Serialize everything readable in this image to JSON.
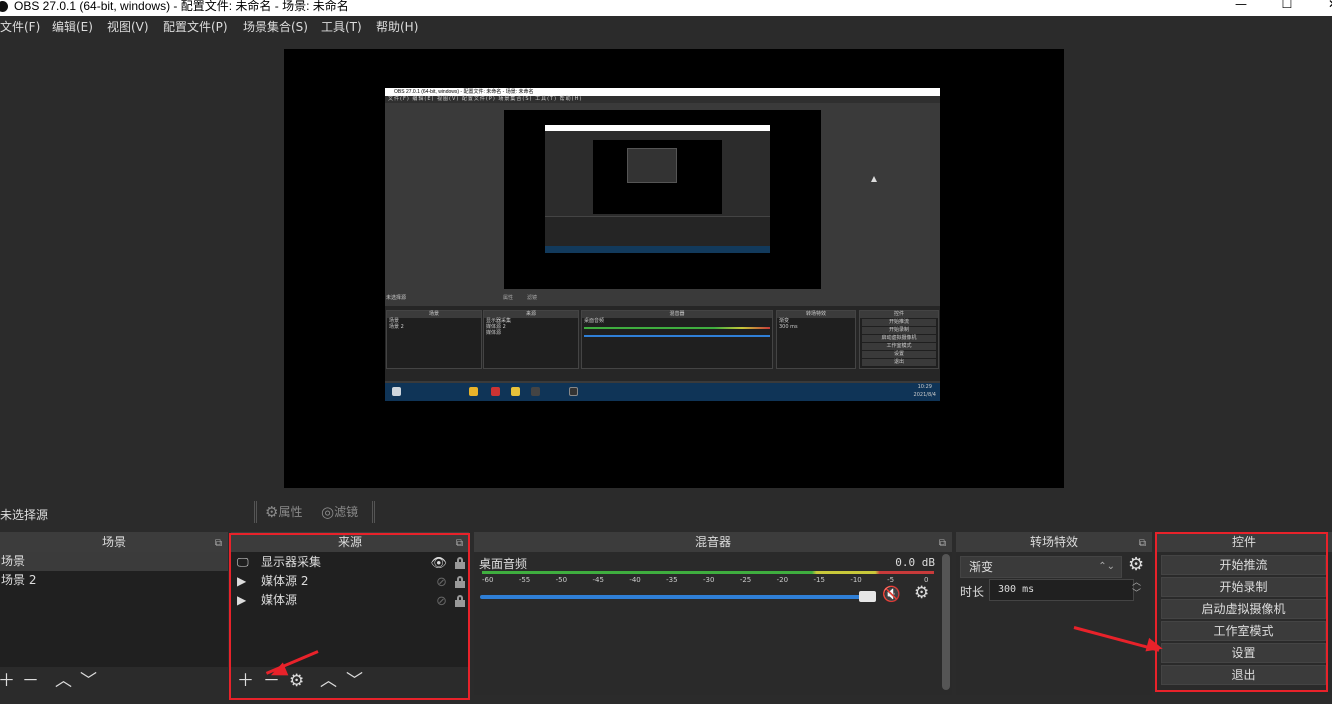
{
  "window": {
    "title": "OBS 27.0.1 (64-bit, windows) - 配置文件: 未命名 - 场景: 未命名",
    "minimize": "—",
    "maximize": "☐",
    "close": "✕"
  },
  "menu": [
    "文件(F)",
    "编辑(E)",
    "视图(V)",
    "配置文件(P)",
    "场景集合(S)",
    "工具(T)",
    "帮助(H)"
  ],
  "nested_preview": {
    "title": "OBS 27.0.1 (64-bit, windows) - 配置文件: 未命名 - 场景: 未命名",
    "menu": "文件(F)  编辑(E)  视图(V)  配置文件(P)  场景集合(S)  工具(T)  帮助(H)",
    "no_source": "未选择源",
    "props": "属性",
    "filters": "滤镜",
    "scenes_header": "场景",
    "sources_header": "来源",
    "mixer_header": "混音器",
    "transitions_header": "转场特效",
    "controls_header": "控件",
    "scenes": [
      "场景",
      "场景 2"
    ],
    "sources": [
      "显示器采集",
      "媒体源 2",
      "媒体源"
    ],
    "mixer_track": "桌面音频",
    "transition": "渐变",
    "duration": "300 ms",
    "controls": [
      "开始推流",
      "开始录制",
      "启动虚拟摄像机",
      "工作室模式",
      "设置",
      "退出"
    ],
    "clock_time": "10:29",
    "clock_date": "2021/8/4"
  },
  "source_toolbar": {
    "no_source": "未选择源",
    "properties": "属性",
    "filters": "滤镜"
  },
  "scenes": {
    "header": "场景",
    "items": [
      "场景",
      "场景 2"
    ]
  },
  "sources": {
    "header": "来源",
    "items": [
      {
        "name": "显示器采集",
        "type_icon": "monitor-icon",
        "visible": true
      },
      {
        "name": "媒体源 2",
        "type_icon": "play-icon",
        "visible": false
      },
      {
        "name": "媒体源",
        "type_icon": "play-icon",
        "visible": false
      }
    ]
  },
  "mixer": {
    "header": "混音器",
    "track": "桌面音频",
    "db": "0.0 dB",
    "scale": [
      "-60",
      "-55",
      "-50",
      "-45",
      "-40",
      "-35",
      "-30",
      "-25",
      "-20",
      "-15",
      "-10",
      "-5",
      "0"
    ],
    "volume_fraction": 1.0,
    "muted": true
  },
  "transitions": {
    "header": "转场特效",
    "selected": "渐变",
    "duration_label": "时长",
    "duration_value": "300 ms"
  },
  "controls": {
    "header": "控件",
    "buttons": [
      "开始推流",
      "开始录制",
      "启动虚拟摄像机",
      "工作室模式",
      "设置",
      "退出"
    ]
  },
  "colors": {
    "annotation_red": "#e8222a",
    "meter_green": "#3fae3f",
    "meter_yellow": "#c8c83a",
    "meter_red": "#c83a3a",
    "volume_blue": "#2f7fd6"
  }
}
